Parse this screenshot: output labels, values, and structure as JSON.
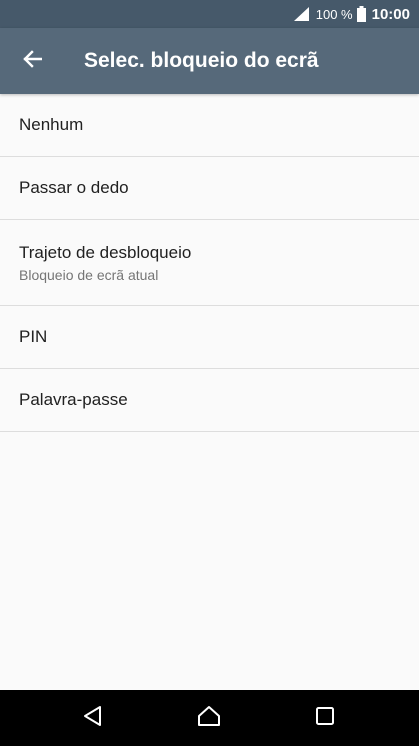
{
  "status_bar": {
    "battery_percent": "100 %",
    "time": "10:00",
    "icons": [
      "signal-icon",
      "battery-icon"
    ]
  },
  "app_bar": {
    "title": "Selec. bloqueio do ecrã",
    "back_icon": "arrow-left-icon"
  },
  "options": [
    {
      "title": "Nenhum",
      "subtitle": ""
    },
    {
      "title": "Passar o dedo",
      "subtitle": ""
    },
    {
      "title": "Trajeto de desbloqueio",
      "subtitle": "Bloqueio de ecrã atual"
    },
    {
      "title": "PIN",
      "subtitle": ""
    },
    {
      "title": "Palavra-passe",
      "subtitle": ""
    }
  ],
  "nav_bar": {
    "icons": [
      "back-triangle-icon",
      "home-icon",
      "recent-apps-icon"
    ]
  },
  "colors": {
    "status_bar": "#46596a",
    "app_bar": "#56697a",
    "background": "#fafafa"
  }
}
